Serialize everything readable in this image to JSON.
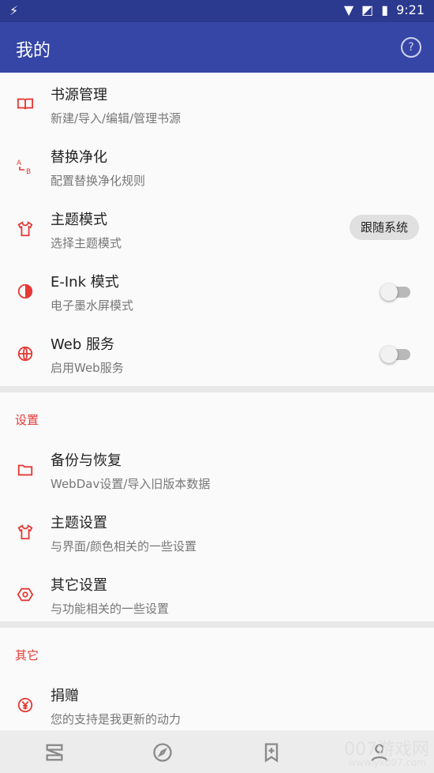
{
  "status_bar": {
    "time": "9:21"
  },
  "app_bar": {
    "title": "我的",
    "help_label": "?"
  },
  "items_main": [
    {
      "title": "书源管理",
      "subtitle": "新建/导入/编辑/管理书源",
      "icon": "book-icon"
    },
    {
      "title": "替换净化",
      "subtitle": "配置替换净化规则",
      "icon": "replace-icon"
    },
    {
      "title": "主题模式",
      "subtitle": "选择主题模式",
      "icon": "shirt-icon",
      "chip": "跟随系统"
    },
    {
      "title": "E-Ink 模式",
      "subtitle": "电子墨水屏模式",
      "icon": "contrast-icon",
      "toggle": false
    },
    {
      "title": "Web 服务",
      "subtitle": "启用Web服务",
      "icon": "globe-icon",
      "toggle": false
    }
  ],
  "settings": {
    "header": "设置",
    "items": [
      {
        "title": "备份与恢复",
        "subtitle": "WebDav设置/导入旧版本数据",
        "icon": "folder-icon"
      },
      {
        "title": "主题设置",
        "subtitle": "与界面/颜色相关的一些设置",
        "icon": "shirt-icon"
      },
      {
        "title": "其它设置",
        "subtitle": "与功能相关的一些设置",
        "icon": "hexagon-settings-icon"
      }
    ]
  },
  "other": {
    "header": "其它",
    "items": [
      {
        "title": "捐赠",
        "subtitle": "您的支持是我更新的动力",
        "icon": "yen-icon"
      }
    ]
  },
  "bottom_nav": [
    "bookshelf-icon",
    "compass-icon",
    "bookmark-add-icon",
    "person-icon"
  ],
  "watermark": {
    "main": "007游戏网",
    "sub": "www.yx007.com"
  },
  "colors": {
    "appbar": "#3646a6",
    "statusbar": "#2b3a8f",
    "accent": "#e53935"
  }
}
